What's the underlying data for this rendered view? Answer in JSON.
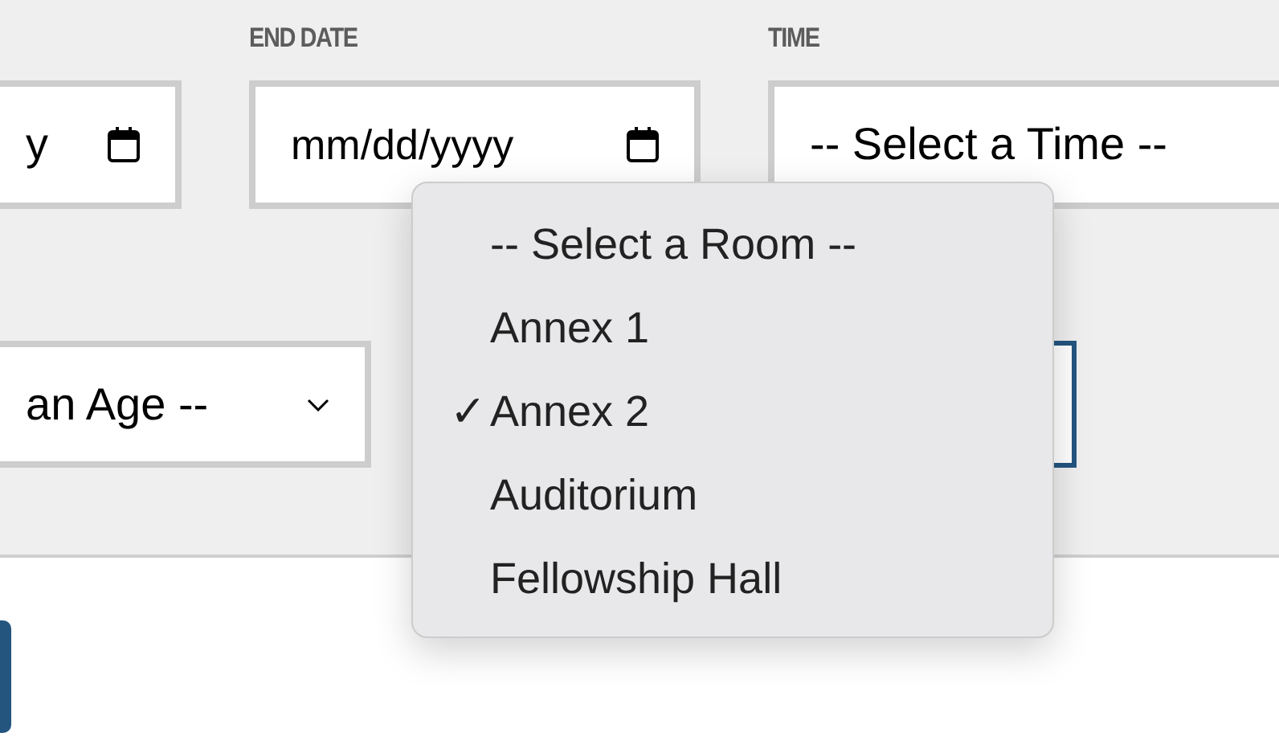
{
  "filters": {
    "labels": [
      "END DATE",
      "TIME"
    ],
    "start_date": {
      "value": "y"
    },
    "end_date": {
      "placeholder": "mm/dd/yyyy"
    },
    "time": {
      "value": "-- Select a Time --"
    },
    "age": {
      "value": "an Age --"
    },
    "room": {
      "focused": true
    }
  },
  "room_menu": [
    {
      "label": "-- Select a Room --",
      "selected": false
    },
    {
      "label": "Annex 1",
      "selected": false
    },
    {
      "label": "Annex 2",
      "selected": true
    },
    {
      "label": "Auditorium",
      "selected": false
    },
    {
      "label": "Fellowship Hall",
      "selected": false
    }
  ],
  "check_mark": "✓"
}
